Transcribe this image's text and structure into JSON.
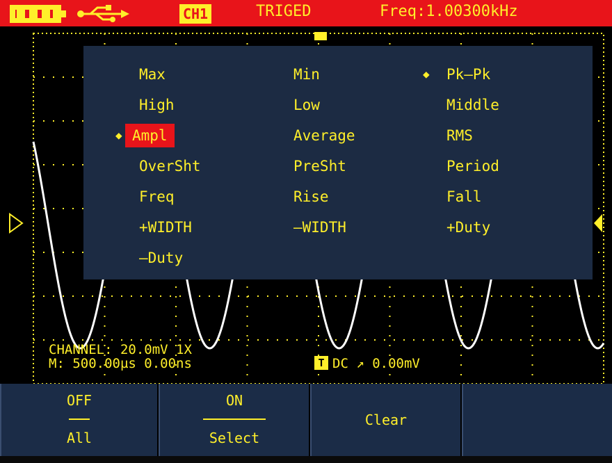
{
  "status_bar": {
    "channel": "CH1",
    "trigger_status": "TRIGED",
    "frequency": "Freq:1.00300kHz",
    "battery_icon": "battery-full-icon",
    "usb_icon": "usb-icon"
  },
  "measure_menu": {
    "items": [
      {
        "label": "Max"
      },
      {
        "label": "Min"
      },
      {
        "label": "Pk–Pk"
      },
      {
        "label": "High"
      },
      {
        "label": "Low"
      },
      {
        "label": "Middle"
      },
      {
        "label": "Ampl"
      },
      {
        "label": "Average"
      },
      {
        "label": "RMS"
      },
      {
        "label": "OverSht"
      },
      {
        "label": "PreSht"
      },
      {
        "label": "Period"
      },
      {
        "label": "Freq"
      },
      {
        "label": "Rise"
      },
      {
        "label": "Fall"
      },
      {
        "label": "+WIDTH"
      },
      {
        "label": "–WIDTH"
      },
      {
        "label": "+Duty"
      },
      {
        "label": "–Duty"
      }
    ],
    "highlighted": "Ampl",
    "marked": [
      "Pk–Pk",
      "Ampl"
    ]
  },
  "scope_info": {
    "channel_line": "CHANNEL: 20.0mV  1X",
    "timebase_line": "M: 500.00µs 0.00ns",
    "trigger_line": "DC ↗ 0.00mV",
    "trigger_badge": "T"
  },
  "softkeys": [
    {
      "top": "OFF",
      "bottom": "All"
    },
    {
      "top": "ON",
      "bottom": "Select"
    },
    {
      "label": "Clear"
    }
  ],
  "colors": {
    "status_bar": "#e8141a",
    "text": "#ffef2a",
    "popup": "#1c2b43",
    "selection": "#e8141a",
    "waveform": "#ffffff"
  }
}
